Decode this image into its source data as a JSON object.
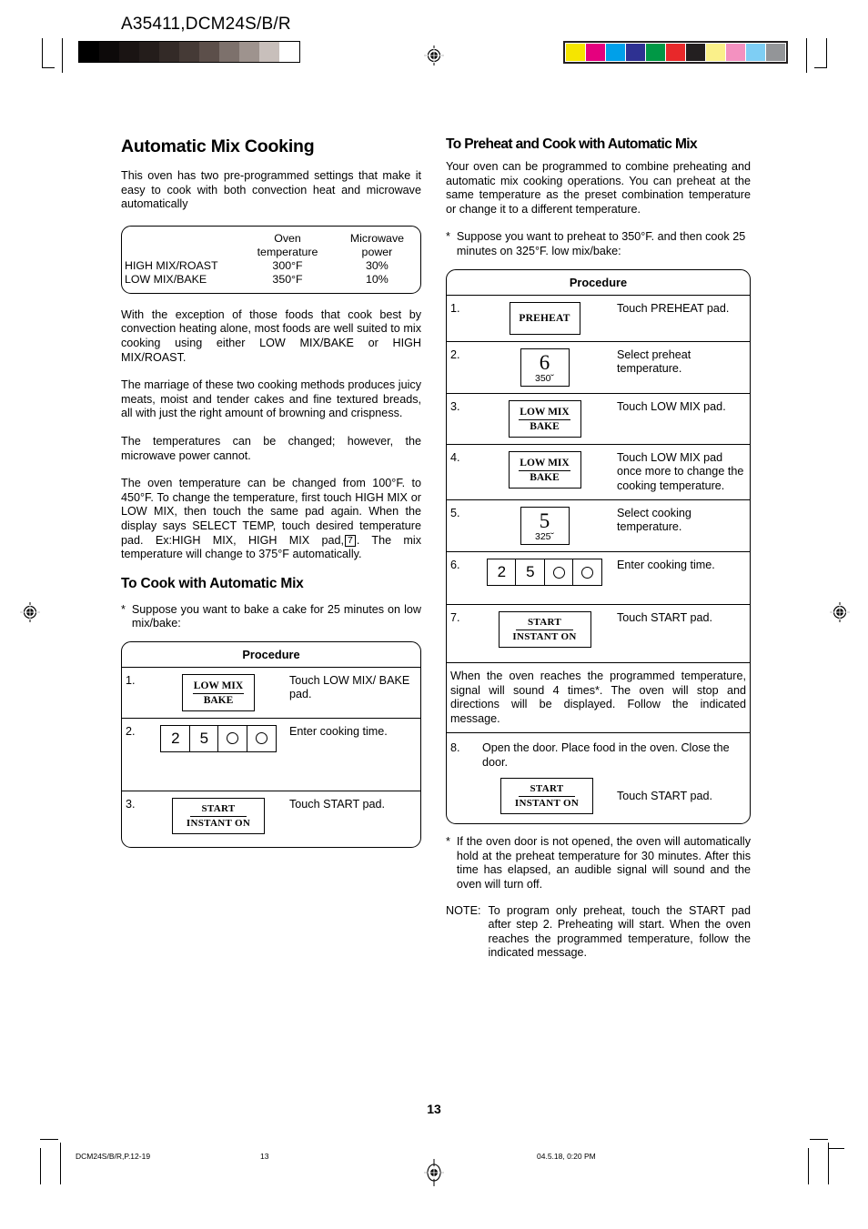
{
  "header": {
    "doc_code": "A35411,DCM24S/B/R",
    "gray_swatches": [
      "#000000",
      "#0d0a0a",
      "#1a1413",
      "#241d1b",
      "#332a27",
      "#453a36",
      "#5c4f4a",
      "#7d716c",
      "#9e938e",
      "#c8bfbb",
      "#ffffff"
    ],
    "color_swatches": [
      "#f5e500",
      "#e5007e",
      "#00a0e9",
      "#2e3192",
      "#009845",
      "#e8282a",
      "#231f20",
      "#faf08a",
      "#f391c0",
      "#7ecef4",
      "#939598"
    ]
  },
  "left_column": {
    "title": "Automatic Mix Cooking",
    "intro": "This oven has two pre-programmed settings that make it easy to cook with both convection heat and microwave automatically",
    "spec_table": {
      "col_head_1_line1": "Oven",
      "col_head_1_line2": "temperature",
      "col_head_2_line1": "Microwave",
      "col_head_2_line2": "power",
      "rows": [
        {
          "label": "HIGH MIX/ROAST",
          "oven_temp": "300°F",
          "mw_power": "30%"
        },
        {
          "label": "LOW MIX/BAKE",
          "oven_temp": "350°F",
          "mw_power": "10%"
        }
      ]
    },
    "para_1": "With the exception of those foods that cook best by convection heating alone, most foods are well suited to mix cooking using either LOW MIX/BAKE or HIGH MIX/ROAST.",
    "para_2": "The marriage of these two cooking methods produces juicy meats, moist and tender cakes and fine textured breads, all with just the right amount of browning and crispness.",
    "para_3": "The temperatures can be changed; however, the microwave power cannot.",
    "para_4_part1": "The oven temperature can be changed from 100°F. to 450°F. To change the temperature, first touch HIGH MIX or LOW MIX, then touch the same pad again. When the display says SELECT TEMP, touch desired temperature pad. Ex:HIGH MIX, HIGH MIX pad,",
    "para_4_key": "7",
    "para_4_part2": ". The mix temperature will change to 375°F automatically.",
    "subsection_title": "To Cook with Automatic Mix",
    "example_star": "*",
    "example_text": "Suppose you want to bake a cake for 25 minutes on low mix/bake:",
    "procedure": {
      "head": "Procedure",
      "steps": [
        {
          "num": "1.",
          "pad_type": "two-line",
          "pad_top": "LOW MIX",
          "pad_bottom": "BAKE",
          "desc": "Touch LOW MIX/ BAKE pad."
        },
        {
          "num": "2.",
          "pad_type": "keypad",
          "keys": [
            "2",
            "5",
            "circle",
            "circle"
          ],
          "desc": "Enter cooking time."
        },
        {
          "num": "3.",
          "pad_type": "start",
          "pad_top": "START",
          "pad_bottom": "INSTANT ON",
          "desc": "Touch START pad."
        }
      ]
    }
  },
  "right_column": {
    "title": "To Preheat and Cook with Automatic Mix",
    "intro": "Your oven can be programmed to combine preheating and automatic mix cooking operations. You can preheat at the same temperature as the preset combination temperature or change it to a different temperature.",
    "example_star": "*",
    "example_text": "Suppose you want to preheat to 350°F. and then cook 25 minutes on 325°F. low mix/bake:",
    "procedure": {
      "head": "Procedure",
      "steps": [
        {
          "num": "1.",
          "pad_type": "preheat",
          "pad_label": "PREHEAT",
          "desc": "Touch PREHEAT pad."
        },
        {
          "num": "2.",
          "pad_type": "temp",
          "big_num": "6",
          "small_temp": "350˘",
          "desc": "Select preheat temperature."
        },
        {
          "num": "3.",
          "pad_type": "two-line",
          "pad_top": "LOW MIX",
          "pad_bottom": "BAKE",
          "desc": "Touch LOW MIX pad."
        },
        {
          "num": "4.",
          "pad_type": "two-line",
          "pad_top": "LOW MIX",
          "pad_bottom": "BAKE",
          "desc": "Touch LOW MIX pad once more to change the cooking temperature."
        },
        {
          "num": "5.",
          "pad_type": "temp",
          "big_num": "5",
          "small_temp": "325˘",
          "desc": "Select cooking temperature."
        },
        {
          "num": "6.",
          "pad_type": "keypad",
          "keys": [
            "2",
            "5",
            "circle",
            "circle"
          ],
          "desc": "Enter cooking time."
        },
        {
          "num": "7.",
          "pad_type": "start",
          "pad_top": "START",
          "pad_bottom": "INSTANT ON",
          "desc": "Touch START pad."
        }
      ],
      "interlude": "When the oven reaches the programmed temperature, signal will sound 4 times*. The oven will stop and directions will be displayed. Follow the indicated message.",
      "step_8": {
        "num": "8.",
        "text": "Open the door. Place food in the oven. Close the door.",
        "pad_top": "START",
        "pad_bottom": "INSTANT ON",
        "desc": "Touch START pad."
      }
    },
    "footnote_star": "*",
    "footnote_text": "If the oven door is not opened, the oven will automatically hold at the preheat temperature for 30 minutes. After this time has elapsed, an audible signal will sound and the oven will turn off.",
    "note_label": "NOTE:",
    "note_text": "To program only preheat, touch the START pad after step 2. Preheating will start. When the oven reaches the programmed temperature, follow the indicated message."
  },
  "page_number": "13",
  "footer": {
    "left": "DCM24S/B/R,P.12-19",
    "middle": "13",
    "right": "04.5.18, 0:20 PM"
  }
}
